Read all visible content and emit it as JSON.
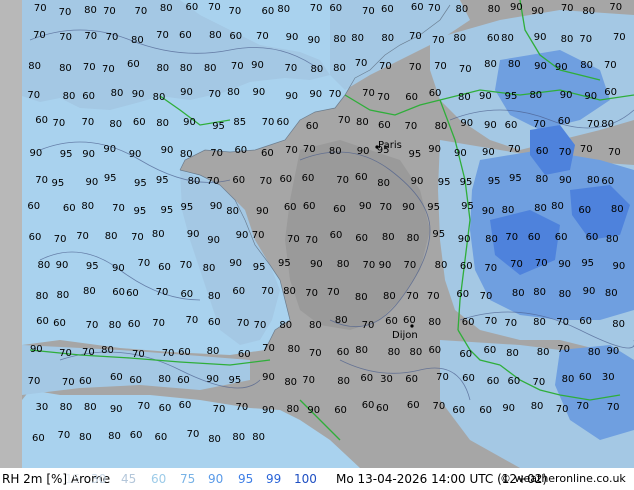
{
  "legend": {
    "title": "RH 2m [%] Arome",
    "levels": [
      {
        "label": "15",
        "color": "#e6ecf2"
      },
      {
        "label": "30",
        "color": "#c9d8e6"
      },
      {
        "label": "45",
        "color": "#b4c7da"
      },
      {
        "label": "60",
        "color": "#9ccbe8"
      },
      {
        "label": "75",
        "color": "#78b3e6"
      },
      {
        "label": "90",
        "color": "#5a9ae8"
      },
      {
        "label": "95",
        "color": "#3f7fe6"
      },
      {
        "label": "99",
        "color": "#2a64d8"
      },
      {
        "label": "100",
        "color": "#1e4fc2"
      }
    ],
    "datetime": "Mo 13-04-2026 14:00 UTC (12+02)",
    "credit": "© weatheronline.co.uk"
  },
  "map": {
    "colors": {
      "sea": "#a9d2ee",
      "land": "#a6a6a6",
      "land_dark": "#9a9a9a",
      "moist": "#a4c8e4",
      "wet": "#6f9fe0",
      "very_wet": "#4e82dc",
      "border": "#2fae3a",
      "contour": "#4a5d8c"
    },
    "cities": [
      "Paris",
      "Dijon"
    ],
    "contour_labels": [
      "70",
      "70",
      "80",
      "70",
      "70",
      "80",
      "60",
      "70",
      "70",
      "60",
      "80",
      "70",
      "60",
      "70",
      "60",
      "60",
      "70",
      "80",
      "80",
      "90",
      "90",
      "70",
      "80",
      "70",
      "70",
      "70",
      "70",
      "70",
      "80",
      "70",
      "60",
      "80",
      "60",
      "70",
      "90",
      "90",
      "80",
      "80",
      "80",
      "70",
      "70",
      "80",
      "60",
      "80",
      "90",
      "80",
      "70",
      "70",
      "80",
      "80",
      "70",
      "70",
      "60",
      "80",
      "80",
      "80",
      "70",
      "90",
      "70",
      "80",
      "80",
      "70",
      "70",
      "70",
      "70",
      "70",
      "80",
      "80",
      "90",
      "90",
      "80",
      "70",
      "70",
      "80",
      "60",
      "80",
      "90",
      "80",
      "90",
      "70",
      "80",
      "90",
      "90",
      "90",
      "70",
      "70",
      "70",
      "60",
      "60",
      "80",
      "90",
      "95",
      "80",
      "90",
      "90",
      "60",
      "60",
      "70",
      "70",
      "80",
      "60",
      "80",
      "90",
      "95",
      "85",
      "70",
      "60",
      "60",
      "70",
      "80",
      "60",
      "70",
      "80",
      "90",
      "90",
      "60",
      "70",
      "60",
      "70",
      "80",
      "90",
      "95",
      "90",
      "90",
      "90",
      "90",
      "80",
      "70",
      "60",
      "60",
      "70",
      "70",
      "80",
      "90",
      "95",
      "95",
      "90",
      "90",
      "90",
      "70",
      "60",
      "70",
      "70",
      "70",
      "70",
      "95",
      "90",
      "95",
      "95",
      "95",
      "80",
      "70",
      "60",
      "70",
      "60",
      "60",
      "70",
      "60",
      "80",
      "90",
      "95",
      "95",
      "95",
      "95",
      "80",
      "90",
      "80",
      "60",
      "60",
      "60",
      "80",
      "70",
      "95",
      "95",
      "95",
      "90",
      "80",
      "90",
      "60",
      "60",
      "60",
      "90",
      "70",
      "90",
      "95",
      "95",
      "90",
      "80",
      "80",
      "80",
      "60",
      "80",
      "60",
      "70",
      "70",
      "80",
      "70",
      "80",
      "90",
      "90",
      "90",
      "70",
      "70",
      "70",
      "60",
      "60",
      "80",
      "80",
      "95",
      "90",
      "80",
      "70",
      "60",
      "60",
      "60",
      "80",
      "80",
      "90",
      "95",
      "90",
      "70",
      "60",
      "70",
      "80",
      "90",
      "95",
      "95",
      "90",
      "80",
      "70",
      "90",
      "70",
      "80",
      "60",
      "70",
      "70",
      "70",
      "90",
      "95",
      "90",
      "80",
      "80",
      "80",
      "60",
      "60",
      "70",
      "60",
      "80",
      "60",
      "70",
      "80",
      "70",
      "70",
      "80",
      "80",
      "70",
      "70",
      "60",
      "70",
      "80",
      "80",
      "80",
      "90",
      "80",
      "60",
      "60",
      "70",
      "80",
      "60",
      "70",
      "70",
      "60",
      "70",
      "70",
      "80",
      "80",
      "80",
      "70",
      "60",
      "60",
      "80",
      "60",
      "70",
      "70",
      "80",
      "70",
      "60",
      "80",
      "90",
      "70",
      "70",
      "80",
      "70",
      "70",
      "60",
      "80",
      "60",
      "70",
      "80",
      "70",
      "60",
      "80",
      "80",
      "80",
      "60",
      "60",
      "60",
      "80",
      "80",
      "70",
      "80",
      "90",
      "70",
      "70",
      "60",
      "60",
      "60",
      "80",
      "60",
      "90",
      "95",
      "90",
      "80",
      "70",
      "80",
      "60",
      "30",
      "60",
      "70",
      "60",
      "60",
      "60",
      "70",
      "80",
      "60",
      "30",
      "30",
      "80",
      "80",
      "90",
      "70",
      "60",
      "60",
      "70",
      "70",
      "90",
      "80",
      "90",
      "60",
      "60",
      "60",
      "60",
      "70",
      "60",
      "60",
      "90",
      "80",
      "70",
      "70",
      "70",
      "60",
      "70",
      "80",
      "80",
      "60",
      "60",
      "70",
      "80",
      "80",
      "80"
    ]
  }
}
